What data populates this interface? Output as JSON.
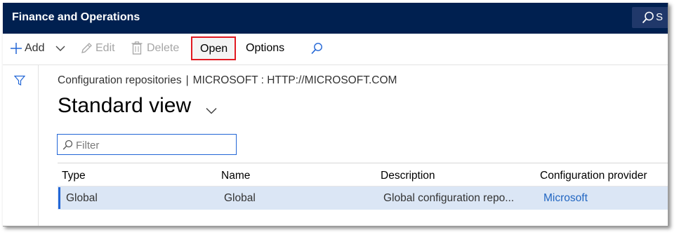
{
  "header": {
    "app_title": "Finance and Operations",
    "search_text": "S"
  },
  "actions": {
    "add": "Add",
    "edit": "Edit",
    "delete": "Delete",
    "open": "Open",
    "options": "Options"
  },
  "breadcrumb": {
    "page": "Configuration repositories",
    "separator": "|",
    "context": "MICROSOFT : HTTP://MICROSOFT.COM"
  },
  "view": {
    "title": "Standard view"
  },
  "filter": {
    "placeholder": "Filter",
    "value": ""
  },
  "grid": {
    "columns": [
      "Type",
      "Name",
      "Description",
      "Configuration provider"
    ],
    "rows": [
      {
        "type": "Global",
        "name": "Global",
        "description": "Global configuration repo...",
        "provider": "Microsoft"
      }
    ]
  },
  "colors": {
    "titlebar": "#002050",
    "accent": "#2266d6",
    "selected_row": "#dbe6f5",
    "highlight_box": "#e11a22",
    "link": "#2266c2"
  },
  "icons": {
    "search": "search-icon",
    "add": "plus-icon",
    "edit": "pencil-icon",
    "delete": "trash-icon",
    "filter_pane": "funnel-icon",
    "view_dropdown": "chevron-down-icon"
  }
}
